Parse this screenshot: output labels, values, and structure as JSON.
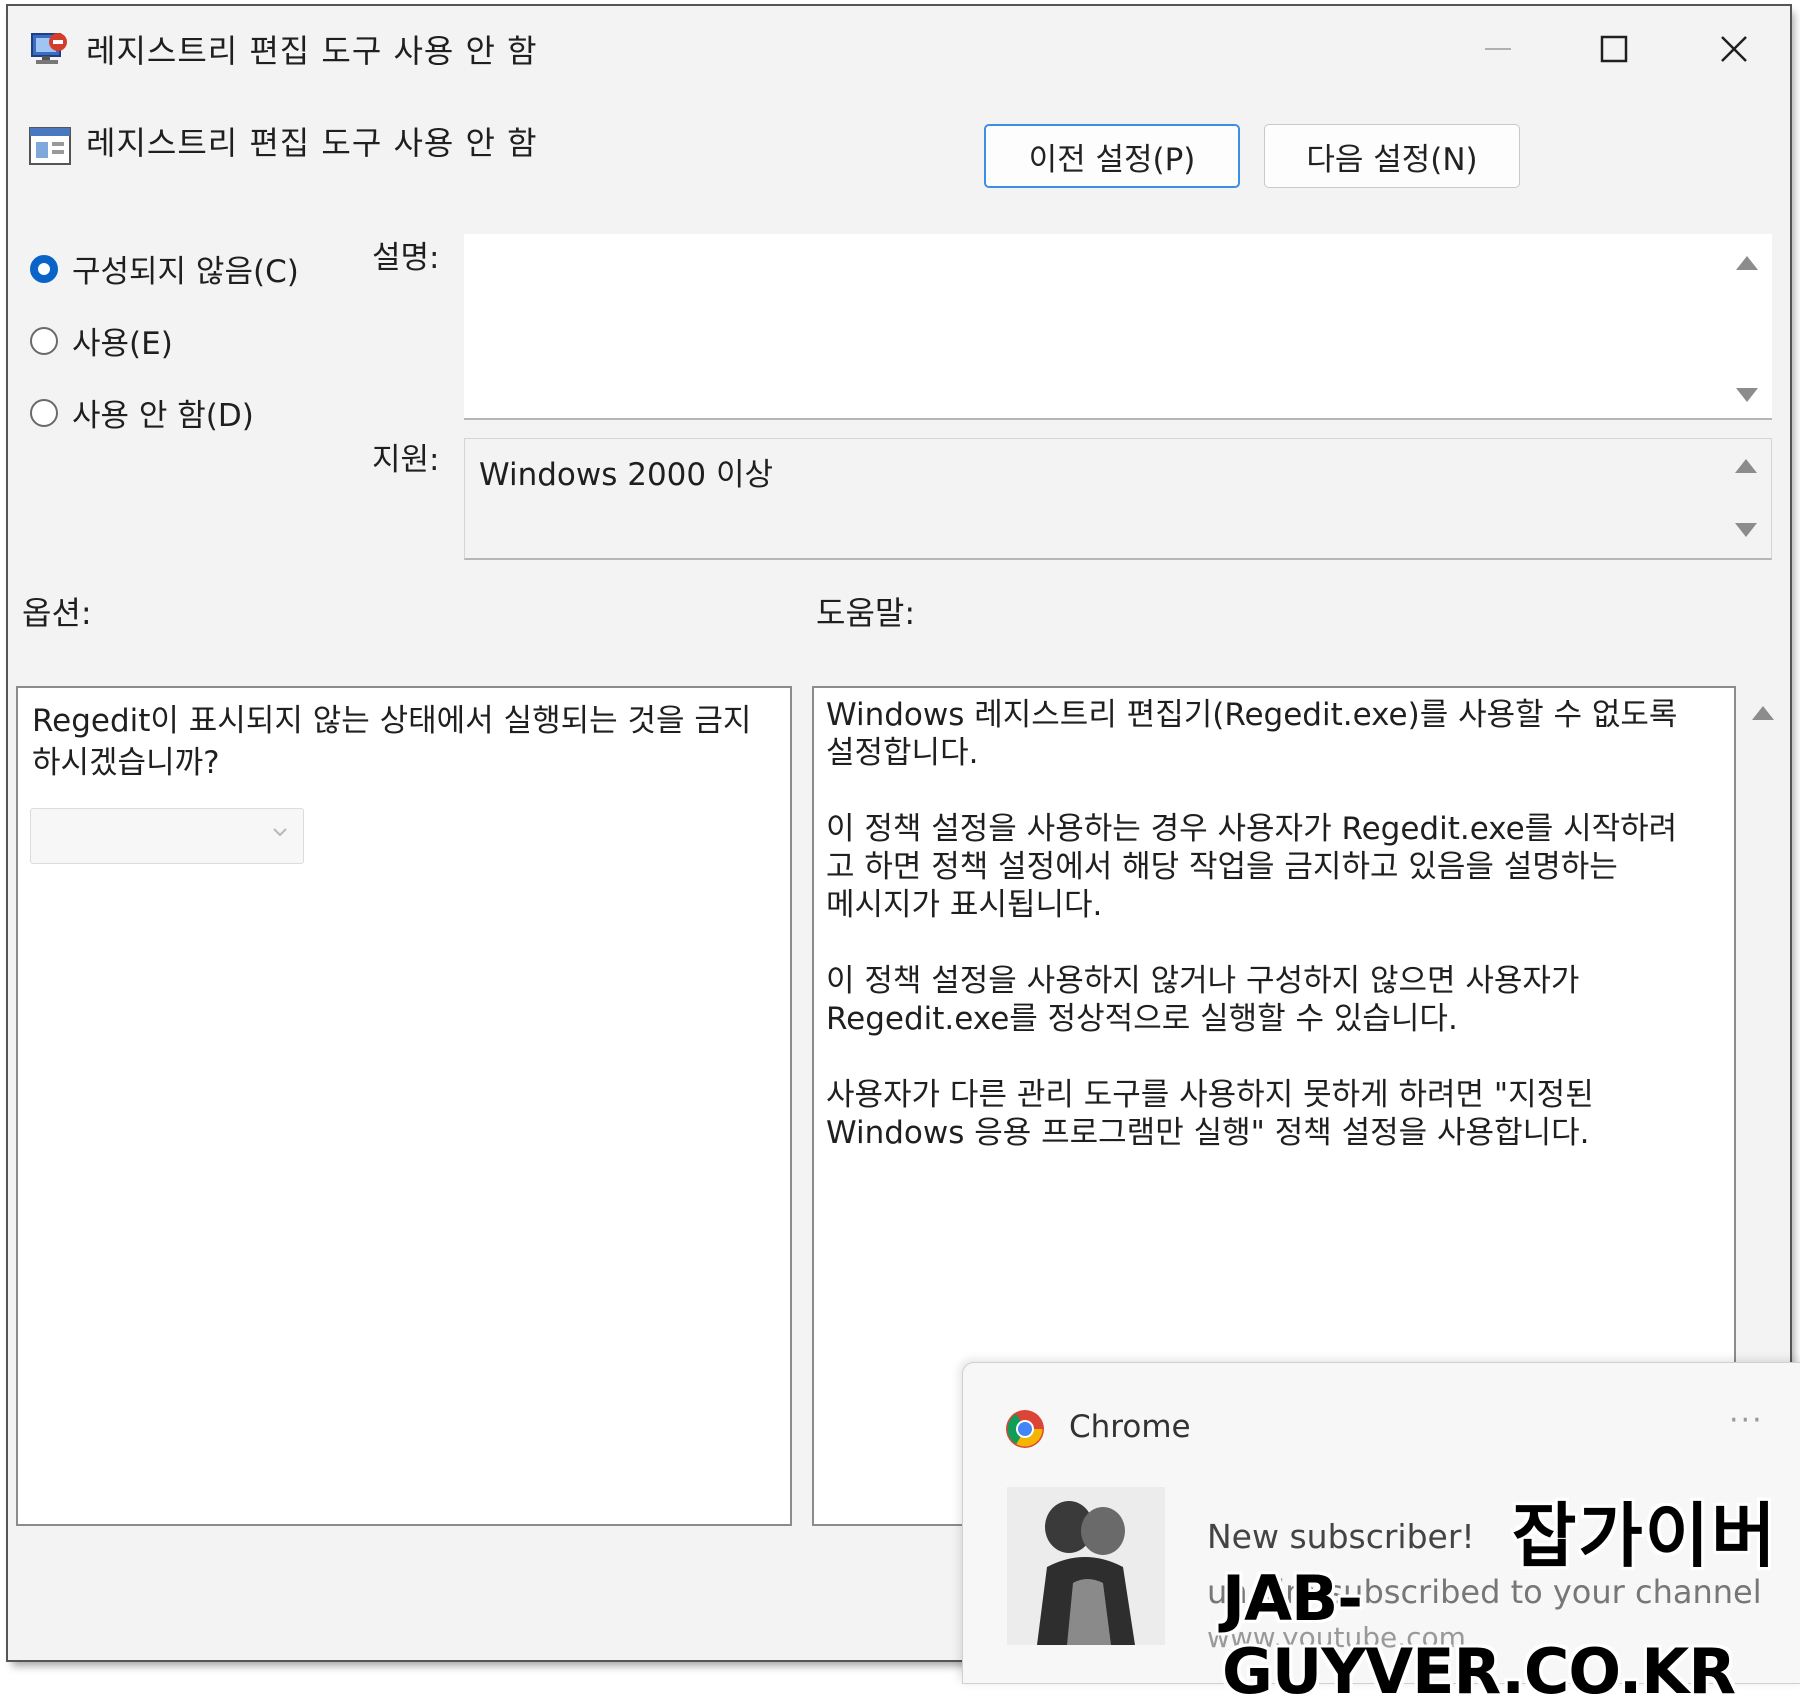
{
  "window": {
    "title": "레지스트리 편집 도구 사용 안 함"
  },
  "header": {
    "policy_title": "레지스트리 편집 도구 사용 안 함",
    "prev_button": "이전 설정(P)",
    "next_button": "다음 설정(N)"
  },
  "state": {
    "options": [
      {
        "label": "구성되지 않음(C)",
        "selected": true
      },
      {
        "label": "사용(E)",
        "selected": false
      },
      {
        "label": "사용 안 함(D)",
        "selected": false
      }
    ]
  },
  "fields": {
    "description_label": "설명:",
    "description_value": "",
    "support_label": "지원:",
    "support_value": "Windows 2000 이상"
  },
  "sections": {
    "options_label": "옵션:",
    "help_label": "도움말:"
  },
  "options_pane": {
    "question": "Regedit이 표시되지 않는 상태에서 실행되는 것을 금지하시겠습니까?",
    "dropdown_value": ""
  },
  "help_pane": {
    "paragraphs": [
      "Windows 레지스트리 편집기(Regedit.exe)를 사용할 수 없도록\n설정합니다.",
      "이 정책 설정을 사용하는 경우 사용자가 Regedit.exe를 시작하려\n고 하면 정책 설정에서 해당 작업을 금지하고 있음을 설명하는\n메시지가 표시됩니다.",
      "이 정책 설정을 사용하지 않거나 구성하지 않으면 사용자가\nRegedit.exe를 정상적으로 실행할 수 있습니다.",
      "사용자가 다른 관리 도구를 사용하지 못하게 하려면 \"지정된\nWindows 응용 프로그램만 실행\" 정책 설정을 사용합니다."
    ]
  },
  "toast": {
    "app_name": "Chrome",
    "more": "···",
    "heading": "New subscriber!",
    "body": "un kim subscribed to your channel",
    "source": "www.youtube.com"
  },
  "watermark": {
    "korean": "잡가이버",
    "url": "JAB-GUYVER.CO.KR"
  },
  "colors": {
    "accent": "#0a63c7",
    "window_bg": "#f3f3f3",
    "focus_border": "#3f8ee6"
  },
  "icons": {
    "app": "registry-policy-icon",
    "header": "policy-setting-icon",
    "toast": "chrome-icon"
  }
}
